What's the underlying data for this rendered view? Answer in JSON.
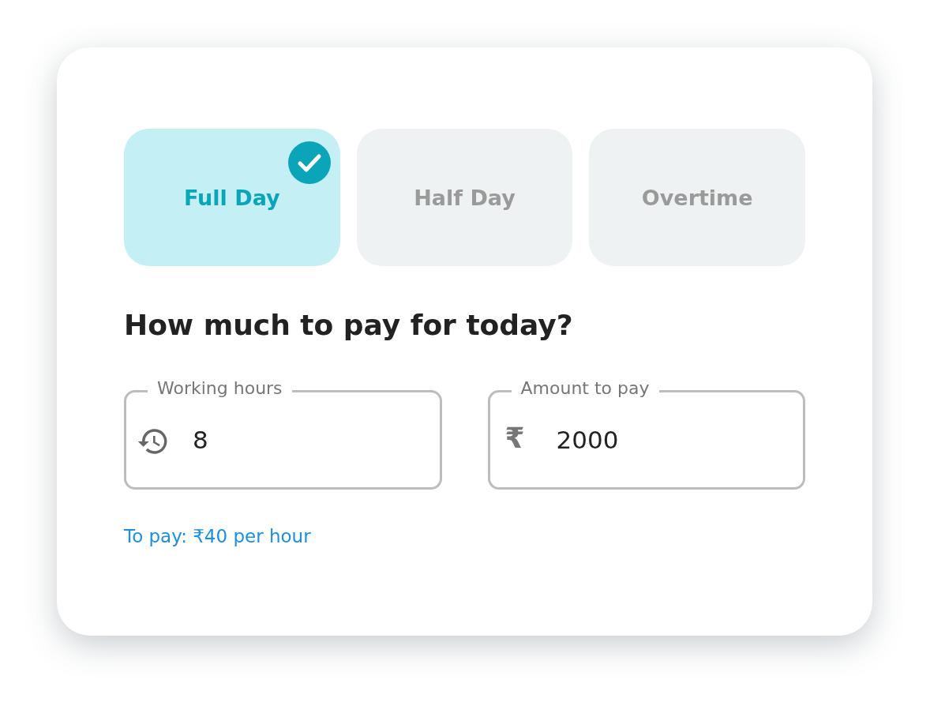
{
  "tabs": [
    {
      "label": "Full Day",
      "selected": true
    },
    {
      "label": "Half Day",
      "selected": false
    },
    {
      "label": "Overtime",
      "selected": false
    }
  ],
  "heading": "How much to pay for today?",
  "fields": [
    {
      "label": "Working hours",
      "kind": "hours",
      "value": "8"
    },
    {
      "label": "Amount to pay",
      "kind": "currency",
      "symbol": "₹",
      "value": "2000"
    }
  ],
  "note": "To pay: ₹40 per hour"
}
